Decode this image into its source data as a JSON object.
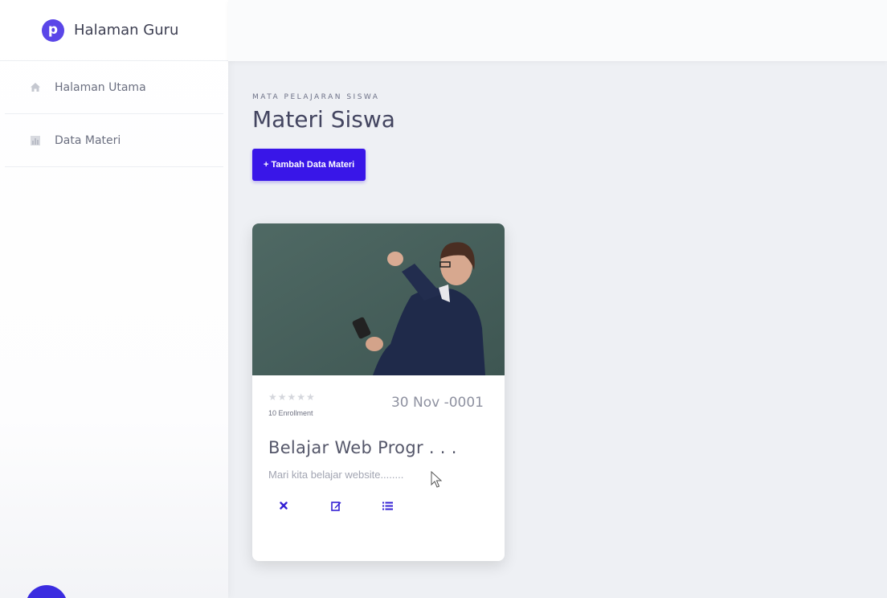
{
  "sidebar": {
    "brand": {
      "logo_letter": "p",
      "title": "Halaman Guru"
    },
    "items": [
      {
        "label": "Halaman Utama",
        "icon": "home-icon"
      },
      {
        "label": "Data Materi",
        "icon": "chart-icon"
      }
    ]
  },
  "main": {
    "eyebrow": "MATA PELAJARAN SISWA",
    "title": "Materi Siswa",
    "add_button": "+ Tambah Data Materi"
  },
  "card": {
    "image_alt": "teacher writing on chalkboard",
    "stars": "★★★★★",
    "date": "30 Nov -0001",
    "enrollment": "10 Enrollment",
    "course_title": "Belajar Web Progr . . .",
    "description": "Mari kita belajar website........",
    "actions": [
      {
        "icon": "delete-icon"
      },
      {
        "icon": "edit-icon"
      },
      {
        "icon": "list-icon"
      }
    ]
  },
  "colors": {
    "accent": "#3916e8",
    "brand": "#5a46e8"
  }
}
